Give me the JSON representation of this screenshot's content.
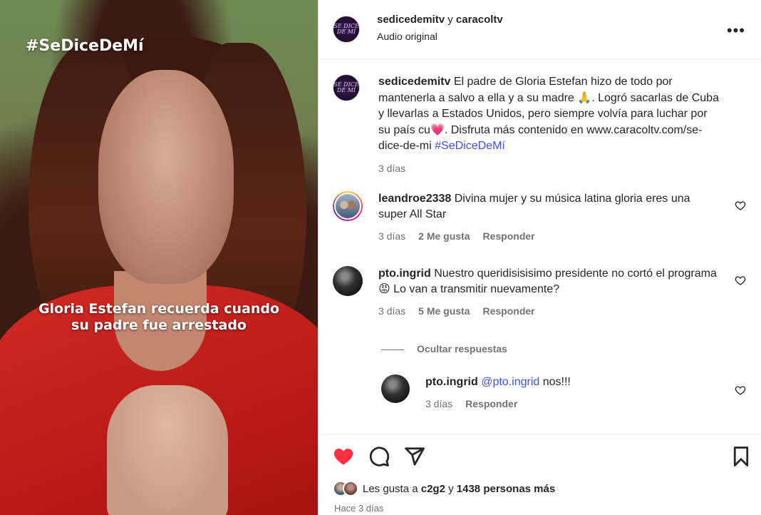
{
  "media": {
    "hashtag_overlay": "#SeDiceDeMí",
    "caption_line1": "Gloria Estefan recuerda cuando",
    "caption_line2": "su padre fue arrestado"
  },
  "header": {
    "logo_text": "SE DICE DE MÍ",
    "user1": "sedicedemitv",
    "sep": " y ",
    "user2": "caracoltv",
    "audio": "Audio original",
    "more_icon": "more-options-icon"
  },
  "post": {
    "username": "sedicedemitv",
    "text_1": " El padre de Gloria Estefan hizo de todo por mantenerla a salvo a ella y a su madre ",
    "emoji_1": "🙏",
    "text_2": ". Logró sacarlas de Cuba y llevarlas a Estados Unidos, pero siempre volvía para luchar por su país cu",
    "emoji_2": "💗",
    "text_3": ". Disfruta más contenido en www.caracoltv.com/se-dice-de-mi ",
    "hashtag": "#SeDiceDeMí",
    "time": "3 días"
  },
  "comments": [
    {
      "username": "leandroe2338",
      "text": " Divina mujer y su música latina gloria eres una super All Star",
      "time": "3 días",
      "likes": "2 Me gusta",
      "reply": "Responder"
    },
    {
      "username": "pto.ingrid",
      "text_1": " Nuestro queridisisisimo presidente no cortó el programa ",
      "emoji": "😡",
      "text_2": "  Lo van a transmitir nuevamente?",
      "time": "3 días",
      "likes": "5 Me gusta",
      "reply": "Responder"
    }
  ],
  "hide_replies": "Ocultar respuestas",
  "reply": {
    "username": "pto.ingrid",
    "mention": "@pto.ingrid",
    "text": " nos!!!",
    "time": "3 días",
    "reply": "Responder"
  },
  "actions": {
    "like_icon": "heart-filled-icon",
    "comment_icon": "comment-icon",
    "share_icon": "share-icon",
    "save_icon": "bookmark-icon",
    "like_color": "#ff3040"
  },
  "likes": {
    "prefix": "Les gusta a ",
    "user": "c2g2",
    "mid": " y ",
    "count": "1438 personas más"
  },
  "posted": "Hace 3 días"
}
